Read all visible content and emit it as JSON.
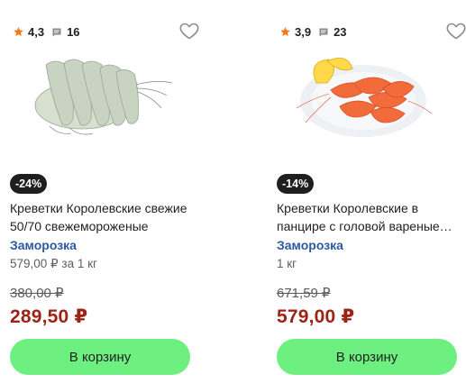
{
  "products": [
    {
      "rating": "4,3",
      "reviews": "16",
      "image": "raw-shrimp-photo",
      "discount": "-24%",
      "title": "Креветки Королевские свежие 50/70 свежемороженые",
      "storage": "Заморозка",
      "unit_price": "579,00 ₽ за 1 кг",
      "old_price": "380,00 ₽",
      "price": "289,50 ₽",
      "button": "В корзину"
    },
    {
      "rating": "3,9",
      "reviews": "23",
      "image": "cooked-shrimp-plate-photo",
      "discount": "-14%",
      "title": "Креветки Королевские в панцире с головой вареные…",
      "storage": "Заморозка",
      "unit_price": "1 кг",
      "old_price": "671,59 ₽",
      "price": "579,00 ₽",
      "button": "В корзину"
    }
  ],
  "colors": {
    "star": "#f07a1a",
    "badge_bg": "#1f1f1f",
    "storage": "#2c5aa0",
    "price": "#9b2417",
    "button_bg": "#6ef081"
  }
}
